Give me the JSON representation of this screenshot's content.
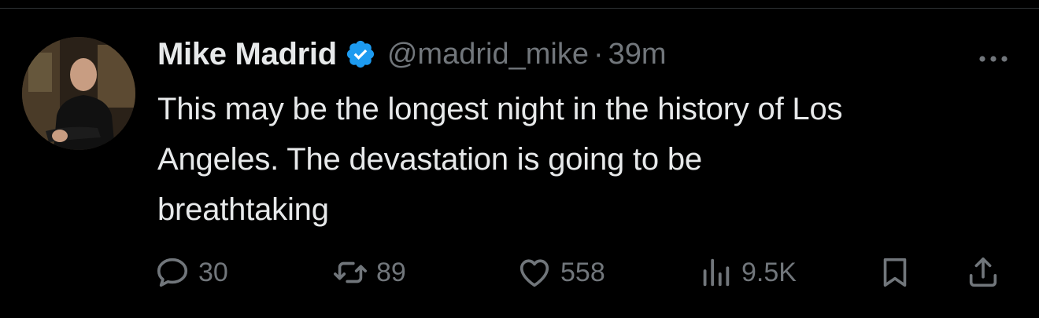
{
  "tweet": {
    "author": {
      "display_name": "Mike Madrid",
      "handle": "@madrid_mike",
      "verified": true
    },
    "separator": "·",
    "timestamp": "39m",
    "text_lines": [
      "This may be the longest night in the history of Los",
      "Angeles. The devastation is going to be",
      "breathtaking"
    ],
    "stats": {
      "replies": "30",
      "reposts": "89",
      "likes": "558",
      "views": "9.5K"
    }
  },
  "icons": {
    "verified": "verified-badge-icon",
    "more": "more-options-icon",
    "reply": "reply-icon",
    "repost": "repost-icon",
    "like": "heart-icon",
    "views": "views-icon",
    "bookmark": "bookmark-icon",
    "share": "share-icon"
  },
  "colors": {
    "background": "#000000",
    "text_primary": "#e7e9ea",
    "text_secondary": "#71767b",
    "verified_blue": "#1d9bf0"
  }
}
